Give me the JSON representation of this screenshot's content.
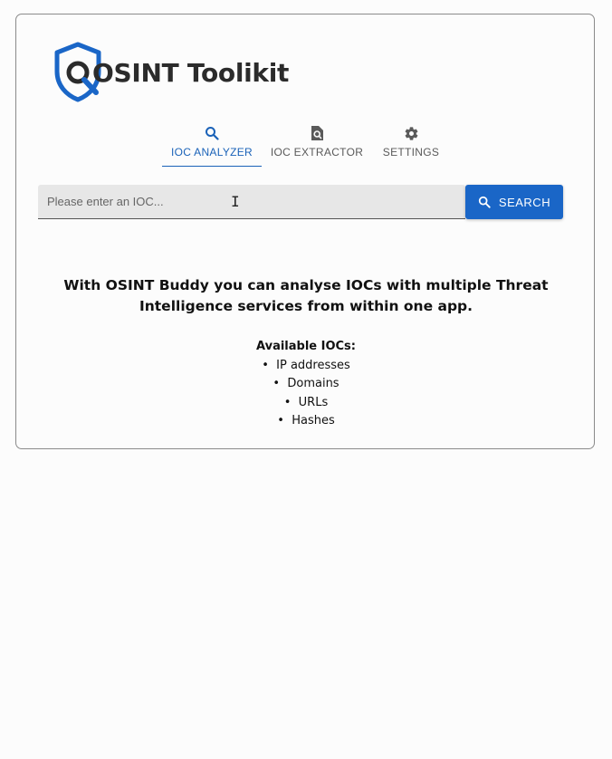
{
  "logo": {
    "title": "OSINT Toolikit",
    "colors": {
      "shield": "#1a66c7",
      "text": "#2b2b2b"
    }
  },
  "tabs": [
    {
      "label": "IOC ANALYZER",
      "icon": "search-icon",
      "active": true
    },
    {
      "label": "IOC EXTRACTOR",
      "icon": "file-search-icon",
      "active": false
    },
    {
      "label": "SETTINGS",
      "icon": "gear-icon",
      "active": false
    }
  ],
  "search": {
    "placeholder": "Please enter an IOC...",
    "value": "",
    "button_label": "SEARCH"
  },
  "main": {
    "headline": "With OSINT Buddy you can analyse IOCs with multiple Threat Intelligence services from within one app.",
    "available_title": "Available IOCs:",
    "iocs": [
      "IP addresses",
      "Domains",
      "URLs",
      "Hashes"
    ]
  },
  "colors": {
    "accent": "#1a66c7",
    "active_tab": "#1a62b8"
  }
}
